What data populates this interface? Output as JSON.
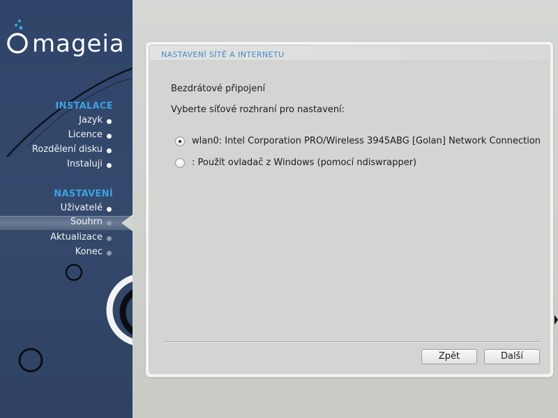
{
  "logo": {
    "text": "mageia"
  },
  "sidebar": {
    "sections": [
      {
        "title": "INSTALACE",
        "items": [
          {
            "label": "Jazyk",
            "state": "done"
          },
          {
            "label": "Licence",
            "state": "done"
          },
          {
            "label": "Rozdělení disku",
            "state": "done"
          },
          {
            "label": "Instaluji",
            "state": "done"
          }
        ]
      },
      {
        "title": "NASTAVENÍ",
        "items": [
          {
            "label": "Uživatelé",
            "state": "done"
          },
          {
            "label": "Souhrn",
            "state": "active"
          },
          {
            "label": "Aktualizace",
            "state": "pending"
          },
          {
            "label": "Konec",
            "state": "pending"
          }
        ]
      }
    ]
  },
  "panel": {
    "title": "NASTAVENÍ SÍTĚ A INTERNETU",
    "heading": "Bezdrátové připojení",
    "prompt": "Vyberte síťové rozhraní pro nastavení:",
    "options": [
      {
        "label": "wlan0: Intel Corporation PRO/Wireless 3945ABG [Golan] Network Connection",
        "selected": true
      },
      {
        "label": ": Použít ovladač z Windows (pomocí ndiswrapper)",
        "selected": false
      }
    ],
    "buttons": {
      "back": "Zpět",
      "next": "Další"
    }
  },
  "colors": {
    "sidebar_bg": "#30466a",
    "section_title": "#3aa3e0",
    "panel_title": "#3d8bd0",
    "window_bg": "#d2d3d0"
  }
}
